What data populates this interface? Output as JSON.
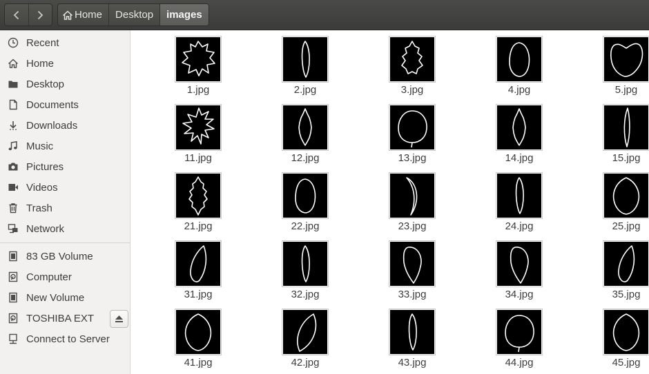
{
  "nav": {
    "back_icon": "chevron-left-icon",
    "forward_icon": "chevron-right-icon"
  },
  "breadcrumb": {
    "home_label": "Home",
    "desktop_label": "Desktop",
    "images_label": "images"
  },
  "sidebar": {
    "items": [
      {
        "label": "Recent",
        "icon": "clock-icon"
      },
      {
        "label": "Home",
        "icon": "home-icon"
      },
      {
        "label": "Desktop",
        "icon": "folder-icon"
      },
      {
        "label": "Documents",
        "icon": "document-icon"
      },
      {
        "label": "Downloads",
        "icon": "download-icon"
      },
      {
        "label": "Music",
        "icon": "music-icon"
      },
      {
        "label": "Pictures",
        "icon": "camera-icon"
      },
      {
        "label": "Videos",
        "icon": "video-icon"
      },
      {
        "label": "Trash",
        "icon": "trash-icon"
      },
      {
        "label": "Network",
        "icon": "network-icon"
      }
    ],
    "devices": [
      {
        "label": "83 GB Volume",
        "icon": "drive-icon"
      },
      {
        "label": "Computer",
        "icon": "harddisk-icon"
      },
      {
        "label": "New Volume",
        "icon": "drive-icon"
      },
      {
        "label": "TOSHIBA EXT",
        "icon": "harddisk-icon"
      },
      {
        "label": "Connect to Server",
        "icon": "server-icon"
      }
    ],
    "eject_icon": "eject-icon"
  },
  "files": [
    {
      "name": "1.jpg",
      "shape": "maple"
    },
    {
      "name": "2.jpg",
      "shape": "slim"
    },
    {
      "name": "3.jpg",
      "shape": "lobed"
    },
    {
      "name": "4.jpg",
      "shape": "oval"
    },
    {
      "name": "5.jpg",
      "shape": "heart"
    },
    {
      "name": "11.jpg",
      "shape": "spiky"
    },
    {
      "name": "12.jpg",
      "shape": "serrated"
    },
    {
      "name": "13.jpg",
      "shape": "round"
    },
    {
      "name": "14.jpg",
      "shape": "serrated"
    },
    {
      "name": "15.jpg",
      "shape": "needle"
    },
    {
      "name": "21.jpg",
      "shape": "toothed"
    },
    {
      "name": "22.jpg",
      "shape": "oval"
    },
    {
      "name": "23.jpg",
      "shape": "crescent"
    },
    {
      "name": "24.jpg",
      "shape": "slim"
    },
    {
      "name": "25.jpg",
      "shape": "wideoval"
    },
    {
      "name": "31.jpg",
      "shape": "tilted"
    },
    {
      "name": "32.jpg",
      "shape": "slim"
    },
    {
      "name": "33.jpg",
      "shape": "pointed"
    },
    {
      "name": "34.jpg",
      "shape": "pointed"
    },
    {
      "name": "35.jpg",
      "shape": "tilted"
    },
    {
      "name": "41.jpg",
      "shape": "wideoval"
    },
    {
      "name": "42.jpg",
      "shape": "lens"
    },
    {
      "name": "43.jpg",
      "shape": "slim"
    },
    {
      "name": "44.jpg",
      "shape": "round"
    },
    {
      "name": "45.jpg",
      "shape": "wideoval"
    }
  ]
}
